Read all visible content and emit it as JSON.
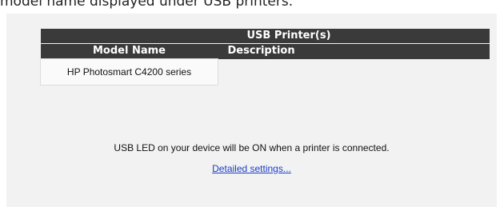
{
  "caption": "model name displayed under USB printers.",
  "table": {
    "title": "USB Printer(s)",
    "headers": [
      "Model Name",
      "Description"
    ],
    "rows": [
      {
        "model": "HP Photosmart C4200 series",
        "description": ""
      }
    ]
  },
  "note": "USB LED on your device will be ON when a printer is connected.",
  "link": "Detailed settings..."
}
